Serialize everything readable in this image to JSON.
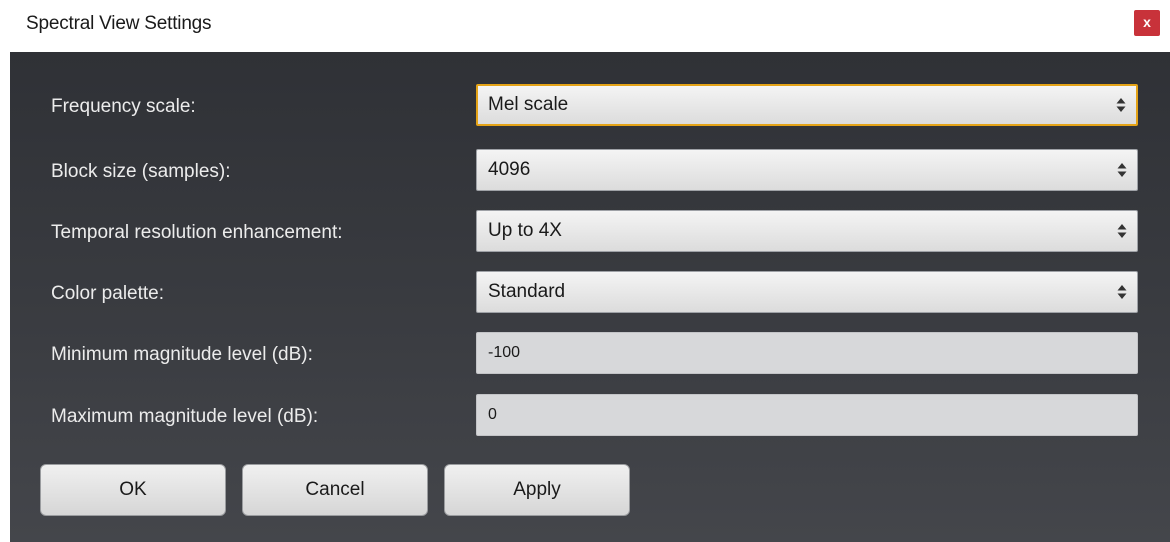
{
  "window": {
    "title": "Spectral View Settings",
    "close_label": "x"
  },
  "settings": [
    {
      "label": "Frequency scale:",
      "value": "Mel scale",
      "kind": "select",
      "focused": true
    },
    {
      "label": "Block size (samples):",
      "value": "4096",
      "kind": "select"
    },
    {
      "label": "Temporal resolution enhancement:",
      "value": "Up to 4X",
      "kind": "select"
    },
    {
      "label": "Color palette:",
      "value": "Standard",
      "kind": "select"
    },
    {
      "label": "Minimum magnitude level (dB):",
      "value": "-100",
      "kind": "input"
    },
    {
      "label": "Maximum magnitude level (dB):",
      "value": "0",
      "kind": "input"
    }
  ],
  "buttons": {
    "ok": "OK",
    "cancel": "Cancel",
    "apply": "Apply"
  },
  "colors": {
    "focus_outline": "#e4a317",
    "close_button": "#c8323a",
    "panel_background": "#35373c"
  },
  "icons": {
    "close": "close-icon",
    "select_arrows": "up-down-arrows-icon"
  }
}
